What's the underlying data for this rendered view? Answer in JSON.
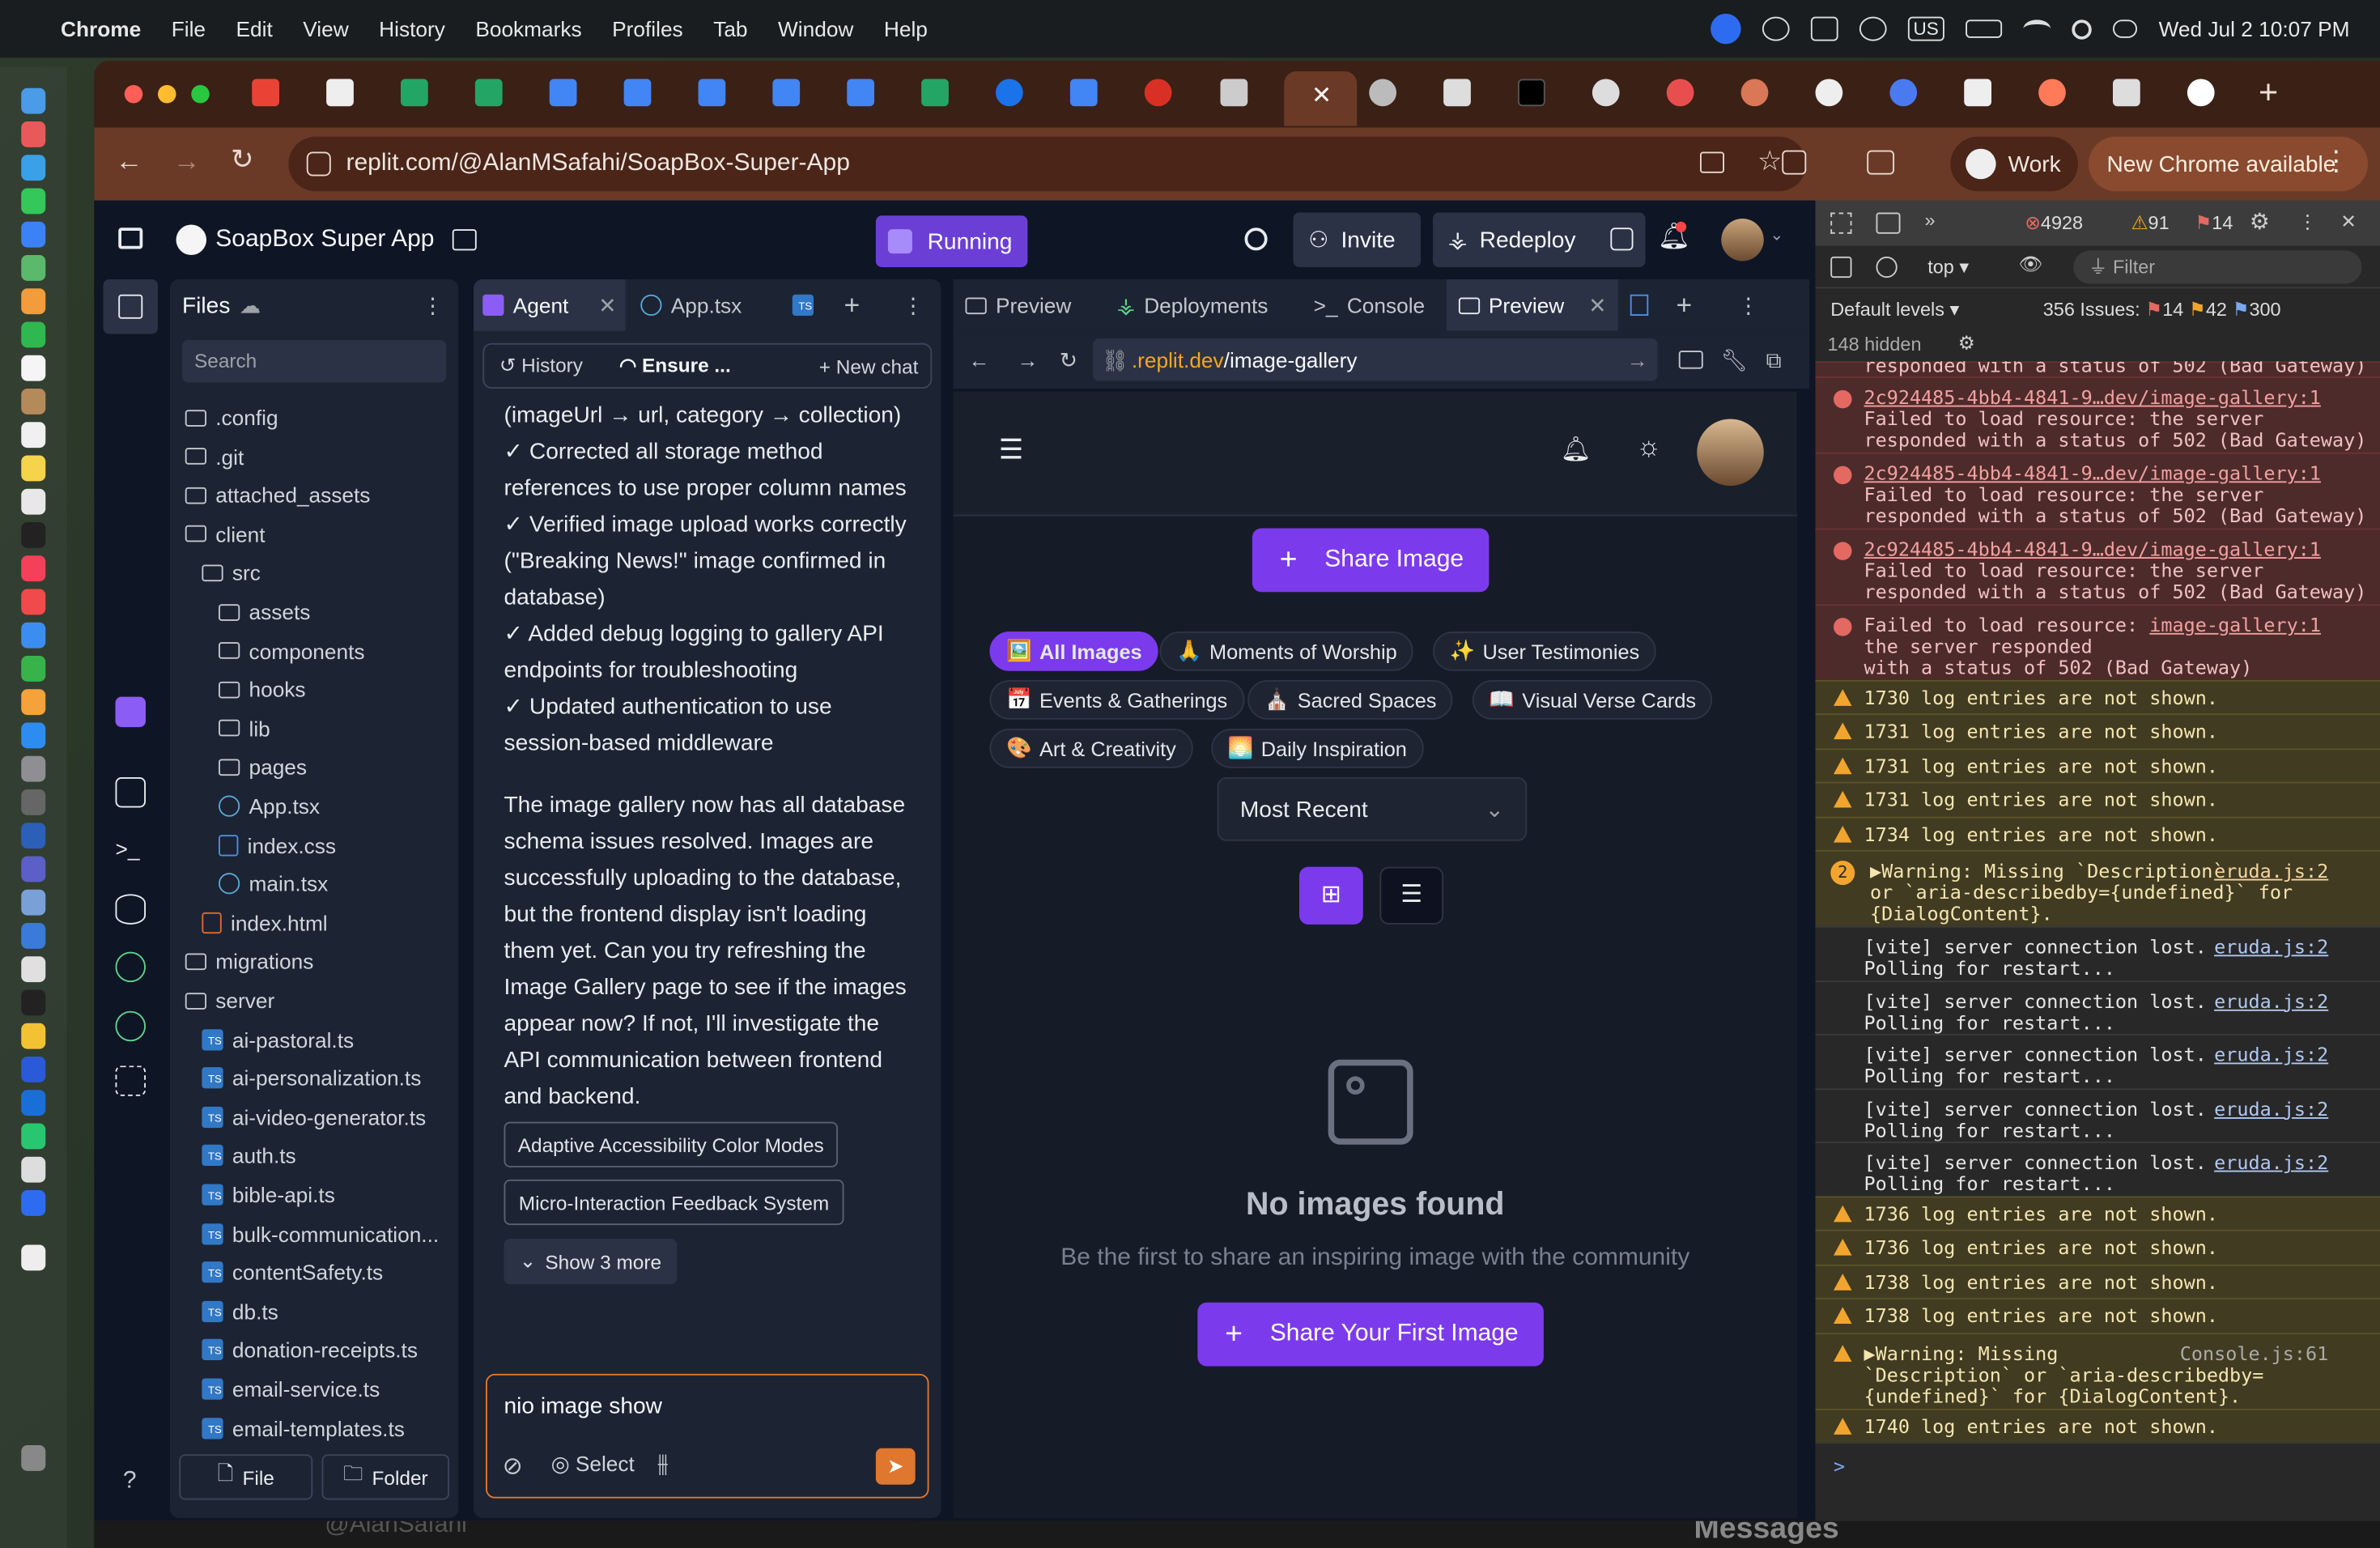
{
  "menubar": {
    "app": "Chrome",
    "items": [
      "File",
      "Edit",
      "View",
      "History",
      "Bookmarks",
      "Profiles",
      "Tab",
      "Window",
      "Help"
    ],
    "input_source": "US",
    "clock": "Wed Jul 2  10:07 PM"
  },
  "browser": {
    "url_plain": "replit.com/@AlanMSafahi/SoapBox-Super-App",
    "profile_label": "Work",
    "update_label": "New Chrome available"
  },
  "replit": {
    "project_name": "SoapBox Super App",
    "run_status": "Running",
    "invite_label": "Invite",
    "redeploy_label": "Redeploy",
    "files": {
      "title": "Files",
      "search_placeholder": "Search",
      "tree": [
        {
          "name": ".config",
          "kind": "folder",
          "indent": 0
        },
        {
          "name": ".git",
          "kind": "folder",
          "indent": 0
        },
        {
          "name": "attached_assets",
          "kind": "folder",
          "indent": 0
        },
        {
          "name": "client",
          "kind": "folder-open",
          "indent": 0
        },
        {
          "name": "src",
          "kind": "folder-open",
          "indent": 1
        },
        {
          "name": "assets",
          "kind": "folder",
          "indent": 2
        },
        {
          "name": "components",
          "kind": "folder",
          "indent": 2
        },
        {
          "name": "hooks",
          "kind": "folder",
          "indent": 2
        },
        {
          "name": "lib",
          "kind": "folder",
          "indent": 2
        },
        {
          "name": "pages",
          "kind": "folder",
          "indent": 2
        },
        {
          "name": "App.tsx",
          "kind": "react",
          "indent": 2
        },
        {
          "name": "index.css",
          "kind": "css",
          "indent": 2
        },
        {
          "name": "main.tsx",
          "kind": "react",
          "indent": 2
        },
        {
          "name": "index.html",
          "kind": "html",
          "indent": 1
        },
        {
          "name": "migrations",
          "kind": "folder",
          "indent": 0
        },
        {
          "name": "server",
          "kind": "folder-open",
          "indent": 0
        },
        {
          "name": "ai-pastoral.ts",
          "kind": "ts",
          "indent": 1
        },
        {
          "name": "ai-personalization.ts",
          "kind": "ts",
          "indent": 1
        },
        {
          "name": "ai-video-generator.ts",
          "kind": "ts",
          "indent": 1
        },
        {
          "name": "auth.ts",
          "kind": "ts",
          "indent": 1
        },
        {
          "name": "bible-api.ts",
          "kind": "ts",
          "indent": 1
        },
        {
          "name": "bulk-communication...",
          "kind": "ts",
          "indent": 1
        },
        {
          "name": "contentSafety.ts",
          "kind": "ts",
          "indent": 1
        },
        {
          "name": "db.ts",
          "kind": "ts",
          "indent": 1
        },
        {
          "name": "donation-receipts.ts",
          "kind": "ts",
          "indent": 1
        },
        {
          "name": "email-service.ts",
          "kind": "ts",
          "indent": 1
        },
        {
          "name": "email-templates.ts",
          "kind": "ts",
          "indent": 1
        }
      ],
      "new_file": "File",
      "new_folder": "Folder"
    },
    "agent": {
      "tabs": [
        "Agent",
        "App.tsx"
      ],
      "history_label": "History",
      "ensure_label": "Ensure ...",
      "new_chat_label": "New chat",
      "lines": [
        "(imageUrl → url, category → collection)",
        "✓ Corrected all storage method",
        "references to use proper column names",
        "✓ Verified image upload works correctly",
        "(\"Breaking News!\" image confirmed in",
        "database)",
        "✓ Added debug logging to gallery API",
        "endpoints for troubleshooting",
        "✓ Updated authentication to use",
        "session-based middleware",
        "",
        "The image gallery now has all database",
        "schema issues resolved. Images are",
        "successfully uploading to the database,",
        "but the frontend display isn't loading",
        "them yet. Can you try refreshing the",
        "Image Gallery page to see if the images",
        "appear now? If not, I'll investigate the",
        "API communication between frontend",
        "and backend."
      ],
      "suggestions": [
        "Adaptive Accessibility Color Modes",
        "Micro-Interaction Feedback System"
      ],
      "show_more": "Show 3 more",
      "input_value": "nio image show",
      "select_label": "Select"
    },
    "preview": {
      "tabs": [
        "Preview",
        "Deployments",
        "Console",
        "Preview"
      ],
      "url_host": ".replit.dev",
      "url_path": "/image-gallery",
      "share_label": "Share Image",
      "categories": [
        {
          "emoji": "🖼️",
          "label": "All Images"
        },
        {
          "emoji": "🙏",
          "label": "Moments of Worship"
        },
        {
          "emoji": "✨",
          "label": "User Testimonies"
        },
        {
          "emoji": "📅",
          "label": "Events & Gatherings"
        },
        {
          "emoji": "⛪",
          "label": "Sacred Spaces"
        },
        {
          "emoji": "📖",
          "label": "Visual Verse Cards"
        },
        {
          "emoji": "🎨",
          "label": "Art & Creativity"
        },
        {
          "emoji": "🌅",
          "label": "Daily Inspiration"
        }
      ],
      "sort_value": "Most Recent",
      "empty_title": "No images found",
      "empty_sub": "Be the first to share an inspiring image with the community",
      "first_share_label": "Share Your First Image"
    }
  },
  "devtools": {
    "counts": {
      "errors": "4928",
      "warnings": "91",
      "info": "14"
    },
    "context": "top",
    "filter_placeholder": "Filter",
    "levels": "Default levels",
    "issues_label": "356 Issues:",
    "issues": {
      "e": "14",
      "w": "42",
      "i": "300"
    },
    "hidden": "148 hidden",
    "top_cut": "responded with a status of 502 (Bad Gateway)",
    "errors": [
      {
        "link": "2c924485-4bb4-4841-9…dev/image-gallery:1",
        "l1": "Failed to load resource: the server",
        "l2": "responded with a status of 502 (Bad Gateway)"
      },
      {
        "link": "2c924485-4bb4-4841-9…dev/image-gallery:1",
        "l1": "Failed to load resource: the server",
        "l2": "responded with a status of 502 (Bad Gateway)"
      },
      {
        "link": "2c924485-4bb4-4841-9…dev/image-gallery:1",
        "l1": "Failed to load resource: the server",
        "l2": "responded with a status of 502 (Bad Gateway)"
      }
    ],
    "error4": {
      "l1": "Failed to load resource:",
      "link": "image-gallery:1",
      "l2": "the server responded",
      "l3": "with a status of 502 (Bad Gateway)"
    },
    "warn_a": [
      "1730 log entries are not shown.",
      "1731 log entries are not shown.",
      "1731 log entries are not shown.",
      "1731 log entries are not shown.",
      "1734 log entries are not shown."
    ],
    "warn_dialog": {
      "badge": "2",
      "l1": "▶Warning: Missing `Description`",
      "l2": "or `aria-describedby={undefined}` for",
      "l3": "{DialogContent}.",
      "src": "eruda.js:2"
    },
    "vite": [
      {
        "l1": "[vite] server connection lost.",
        "l2": "Polling for restart...",
        "src": "eruda.js:2"
      },
      {
        "l1": "[vite] server connection lost.",
        "l2": "Polling for restart...",
        "src": "eruda.js:2"
      },
      {
        "l1": "[vite] server connection lost.",
        "l2": "Polling for restart...",
        "src": "eruda.js:2"
      },
      {
        "l1": "[vite] server connection lost.",
        "l2": "Polling for restart...",
        "src": "eruda.js:2"
      },
      {
        "l1": "[vite] server connection lost.",
        "l2": "Polling for restart...",
        "src": "eruda.js:2"
      }
    ],
    "warn_b": [
      "1736 log entries are not shown.",
      "1736 log entries are not shown.",
      "1738 log entries are not shown.",
      "1738 log entries are not shown."
    ],
    "warn_dialog2": {
      "l1": "▶Warning: Missing",
      "l2": "`Description` or `aria-describedby=",
      "l3": "{undefined}` for {DialogContent}.",
      "src": "Console.js:61"
    },
    "warn_last": "1740 log entries are not shown.",
    "prompt": ">"
  },
  "behind": {
    "user": "@AlanSafahi",
    "messages": "Messages"
  }
}
